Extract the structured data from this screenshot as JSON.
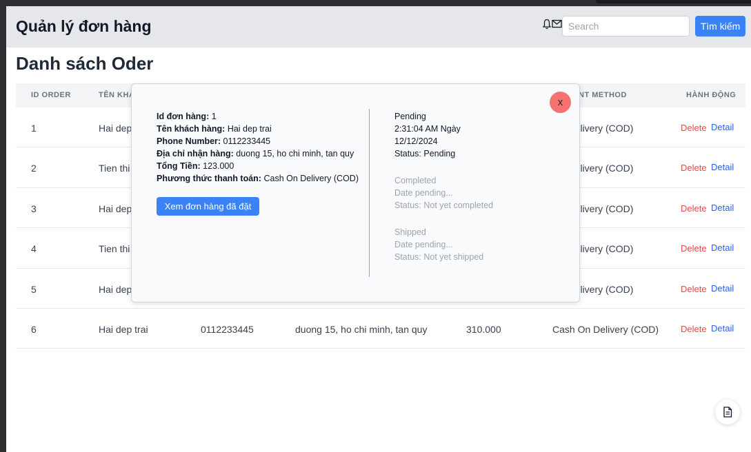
{
  "header": {
    "title": "Quản lý đơn hàng",
    "search_placeholder": "Search",
    "search_button": "Tìm kiếm",
    "icons": [
      "bell-icon",
      "mail-icon"
    ]
  },
  "page_title": "Danh sách Oder",
  "table": {
    "headers": {
      "id": "ID ORDER",
      "name": "TÊN KHÁ",
      "method": "NT METHOD",
      "action": "HÀNH ĐỘNG"
    },
    "rows": [
      {
        "id": "1",
        "name": "Hai dep",
        "phone": "",
        "address": "",
        "total": "",
        "method": "On Delivery (COD)",
        "delete": "Delete",
        "detail": "Detail"
      },
      {
        "id": "2",
        "name": "Tien thi",
        "phone": "",
        "address": "",
        "total": "",
        "method": "On Delivery (COD)",
        "delete": "Delete",
        "detail": "Detail"
      },
      {
        "id": "3",
        "name": "Hai dep",
        "phone": "",
        "address": "",
        "total": "",
        "method": "On Delivery (COD)",
        "delete": "Delete",
        "detail": "Detail"
      },
      {
        "id": "4",
        "name": "Tien thi",
        "phone": "",
        "address": "",
        "total": "",
        "method": "On Delivery (COD)",
        "delete": "Delete",
        "detail": "Detail"
      },
      {
        "id": "5",
        "name": "Hai dep",
        "phone": "",
        "address": "",
        "total": "",
        "method": "On Delivery (COD)",
        "delete": "Delete",
        "detail": "Detail"
      },
      {
        "id": "6",
        "name": "Hai dep trai",
        "phone": "0112233445",
        "address": "duong 15, ho chi minh, tan quy",
        "total": "310.000",
        "method": "Cash On Delivery (COD)",
        "delete": "Delete",
        "detail": "Detail"
      }
    ]
  },
  "modal": {
    "close_label": "x",
    "order_id_label": "Id đơn hàng:",
    "order_id": "1",
    "customer_label": "Tên khách hàng:",
    "customer": "Hai dep trai",
    "phone_label": "Phone Number:",
    "phone": "0112233445",
    "address_label": "Địa chỉ nhận hàng:",
    "address": "duong 15, ho chi minh, tan quy",
    "total_label": "Tổng Tiền:",
    "total": "123.000",
    "payment_label": "Phương thức thanh toán:",
    "payment": "Cash On Delivery (COD)",
    "view_button": "Xem đơn hàng đã đặt",
    "status_pending": {
      "title": "Pending",
      "time": "2:31:04 AM Ngày",
      "date": "12/12/2024",
      "status": "Status: Pending"
    },
    "status_completed": {
      "title": "Completed",
      "date": "Date pending...",
      "status": "Status: Not yet completed"
    },
    "status_shipped": {
      "title": "Shipped",
      "date": "Date pending...",
      "status": "Status: Not yet shipped"
    }
  },
  "fab": {
    "icon": "document-icon"
  },
  "colors": {
    "primary": "#3b82f6",
    "danger": "#ef4444",
    "link": "#2563eb",
    "close": "#f87171"
  }
}
